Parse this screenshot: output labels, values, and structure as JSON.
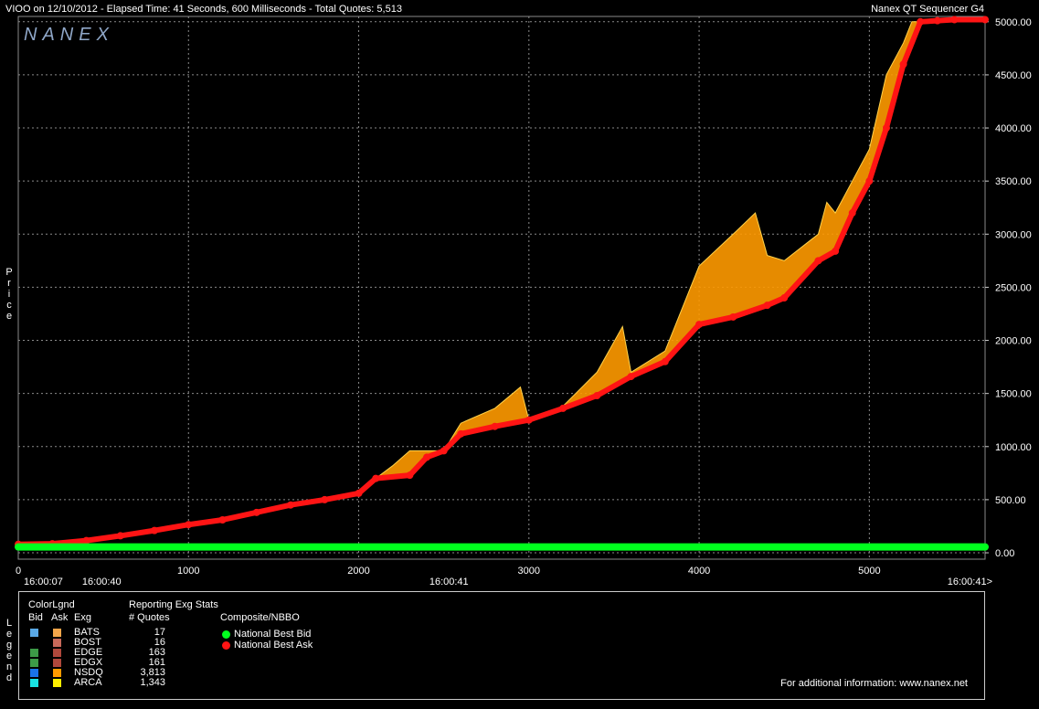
{
  "header": {
    "left": "VIOO on 12/10/2012  -  Elapsed Time: 41 Seconds, 600 Milliseconds  -  Total Quotes: 5,513",
    "right": "Nanex QT Sequencer G4"
  },
  "watermark": "NANEX",
  "price_label": "Price",
  "legend_label": "Legend",
  "colors": {
    "grid": "#8a8a8a",
    "bid_line": "#00ff1e",
    "ask_line": "#ff1414",
    "spread_fill": "#ff9a00"
  },
  "chart_data": {
    "type": "line",
    "xlim": [
      0,
      5680
    ],
    "ylim": [
      -60,
      5050
    ],
    "x_ticks": [
      "1000",
      "2000",
      "3000",
      "4000",
      "5000"
    ],
    "x_tick_values": [
      1000,
      2000,
      3000,
      4000,
      5000
    ],
    "y_ticks": [
      "0.00",
      "500.00",
      "1000.00",
      "1500.00",
      "2000.00",
      "2500.00",
      "3000.00",
      "3500.00",
      "4000.00",
      "4500.00",
      "5000.00"
    ],
    "y_tick_values": [
      0,
      500,
      1000,
      1500,
      2000,
      2500,
      3000,
      3500,
      4000,
      4500,
      5000
    ],
    "time_labels": [
      {
        "text": "0",
        "x": 0
      },
      {
        "text": "16:00:07",
        "x": 0
      },
      {
        "text": "16:00:40",
        "x": 490
      },
      {
        "text": "16:00:41",
        "x": 2530
      },
      {
        "text": "16:00:41>",
        "x": 5680
      }
    ],
    "series": [
      {
        "name": "National Best Bid",
        "x": [
          0,
          5680
        ],
        "y": [
          55,
          55
        ]
      },
      {
        "name": "National Best Ask",
        "x": [
          0,
          200,
          400,
          600,
          800,
          1000,
          1200,
          1400,
          1600,
          1800,
          2000,
          2100,
          2300,
          2400,
          2500,
          2600,
          2800,
          3000,
          3200,
          3400,
          3600,
          3800,
          4000,
          4200,
          4400,
          4500,
          4700,
          4800,
          4900,
          5000,
          5100,
          5200,
          5300,
          5400,
          5500,
          5680
        ],
        "y": [
          80,
          85,
          115,
          160,
          210,
          265,
          310,
          380,
          450,
          500,
          560,
          700,
          730,
          900,
          960,
          1120,
          1190,
          1250,
          1360,
          1480,
          1660,
          1800,
          2150,
          2220,
          2330,
          2400,
          2750,
          2840,
          3200,
          3500,
          4000,
          4600,
          5000,
          5010,
          5020,
          5020
        ]
      },
      {
        "name": "Ask spikes",
        "x": [
          0,
          200,
          400,
          600,
          800,
          1000,
          1200,
          1400,
          1600,
          1800,
          2000,
          2100,
          2200,
          2300,
          2400,
          2500,
          2600,
          2800,
          2950,
          3000,
          3200,
          3400,
          3550,
          3600,
          3800,
          3900,
          4000,
          4200,
          4330,
          4400,
          4500,
          4700,
          4750,
          4800,
          4900,
          5000,
          5100,
          5200,
          5250,
          5300,
          5400,
          5500,
          5680
        ],
        "y": [
          80,
          85,
          115,
          160,
          210,
          265,
          310,
          380,
          450,
          500,
          560,
          700,
          820,
          960,
          960,
          960,
          1220,
          1360,
          1560,
          1250,
          1380,
          1700,
          2130,
          1700,
          1900,
          2300,
          2700,
          3000,
          3200,
          2800,
          2750,
          3000,
          3300,
          3200,
          3500,
          3800,
          4500,
          4800,
          5000,
          5000,
          5010,
          5020,
          5020
        ]
      }
    ]
  },
  "legend": {
    "color_title": "ColorLgnd",
    "stats_title": "Reporting Exg Stats",
    "col_bid": "Bid",
    "col_ask": "Ask",
    "col_exg": "Exg",
    "col_quotes": "# Quotes",
    "composite_title": "Composite/NBBO",
    "rows": [
      {
        "exg": "BATS",
        "quotes": "17",
        "bid": "#5aa9e6",
        "ask": "#f4a64a"
      },
      {
        "exg": "BOST",
        "quotes": "16",
        "bid": "#000000",
        "ask": "#c8695a"
      },
      {
        "exg": "EDGE",
        "quotes": "163",
        "bid": "#3d9b47",
        "ask": "#b0483c"
      },
      {
        "exg": "EDGX",
        "quotes": "161",
        "bid": "#3d9b47",
        "ask": "#b0483c"
      },
      {
        "exg": "NSDQ",
        "quotes": "3,813",
        "bid": "#1a73e8",
        "ask": "#ff9a00"
      },
      {
        "exg": "ARCA",
        "quotes": "1,343",
        "bid": "#19e3e3",
        "ask": "#ffee00"
      }
    ],
    "nbbo": [
      {
        "label": "National Best Bid",
        "color": "#00ff1e"
      },
      {
        "label": "National Best Ask",
        "color": "#ff1414"
      }
    ],
    "footer": "For additional information: www.nanex.net"
  }
}
